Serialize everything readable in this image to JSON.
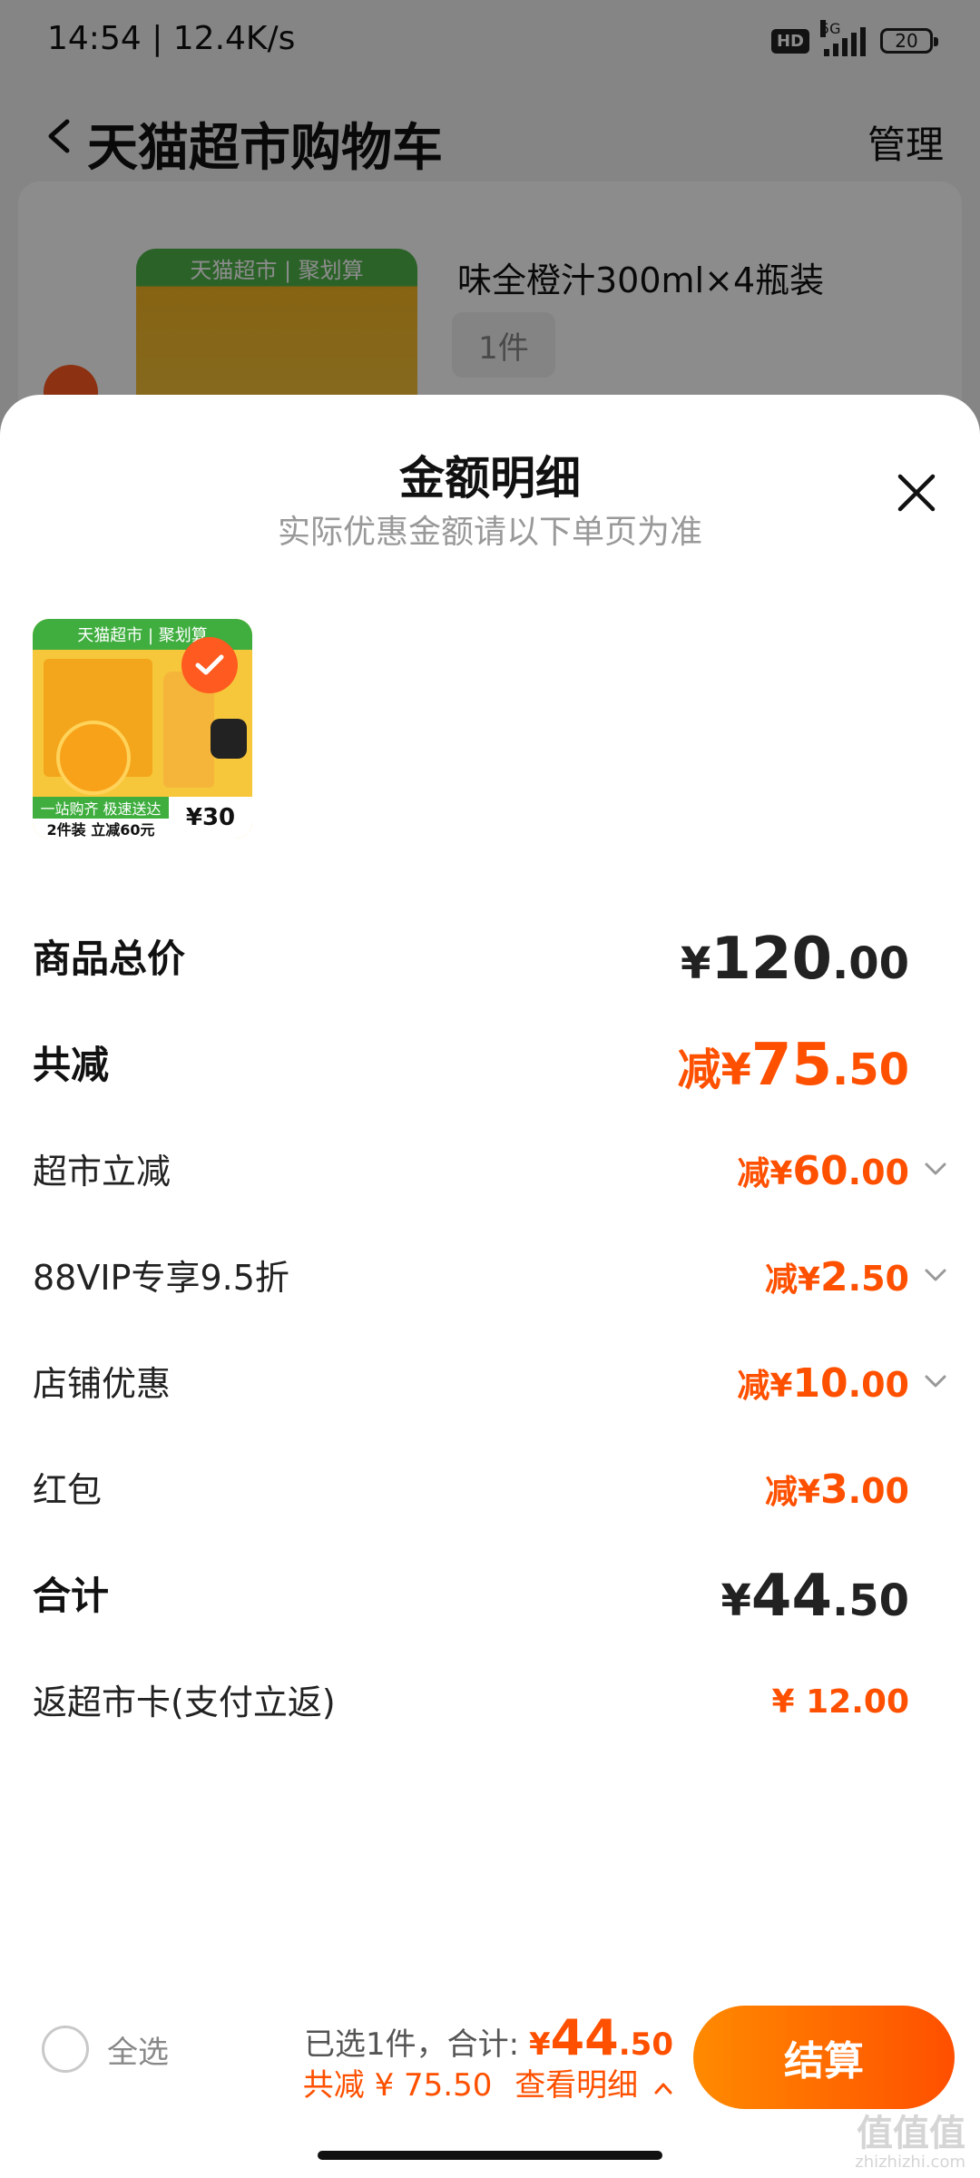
{
  "status_bar": {
    "time": "14:54 | 12.4K/s",
    "hd": "HD",
    "network": "5G",
    "battery": "20"
  },
  "nav": {
    "title": "天猫超市购物车",
    "manage": "管理"
  },
  "background_item": {
    "name": "味全橙汁300ml×4瓶装",
    "quantity": "1件",
    "thumb_tag": "天猫超市 | 聚划算"
  },
  "sheet": {
    "title": "金额明细",
    "subtitle": "实际优惠金额请以下单页为准",
    "thumb": {
      "top_tag": "天猫超市 | 聚划算",
      "strip1": "一站购齐 极速送达",
      "strip2": "2件装 立减60元",
      "price": "¥30"
    },
    "rows": [
      {
        "label": "商品总价",
        "prefix": "¥",
        "int": "120",
        "dec": ".00",
        "style": "total-black",
        "chevron": false
      },
      {
        "label": "共减",
        "prefix": "减¥",
        "int": "75",
        "dec": ".50",
        "style": "total-orange",
        "chevron": false
      },
      {
        "label": "超市立减",
        "prefix": "减¥",
        "int": "60",
        "dec": ".00",
        "style": "item",
        "chevron": true
      },
      {
        "label": "88VIP专享9.5折",
        "prefix": "减¥",
        "int": "2",
        "dec": ".50",
        "style": "item",
        "chevron": true
      },
      {
        "label": "店铺优惠",
        "prefix": "减¥",
        "int": "10",
        "dec": ".00",
        "style": "item",
        "chevron": true
      },
      {
        "label": "红包",
        "prefix": "减¥",
        "int": "3",
        "dec": ".00",
        "style": "item",
        "chevron": false
      },
      {
        "label": "合计",
        "prefix": "¥",
        "int": "44",
        "dec": ".50",
        "style": "total-black",
        "chevron": false
      },
      {
        "label": "返超市卡(支付立返)",
        "prefix": "¥ ",
        "int": "12",
        "dec": ".00",
        "style": "rebate",
        "chevron": false
      }
    ]
  },
  "bottom_bar": {
    "select_all": "全选",
    "selected_text": "已选1件，合计: ",
    "total_prefix": "¥",
    "total_int": "44",
    "total_dec": ".50",
    "discount_text": "共减 ¥ 75.50",
    "view_detail": "查看明细",
    "checkout": "结算"
  },
  "watermark": {
    "main": "值值值",
    "sub": "zhizhizhi.com"
  },
  "colors": {
    "accent": "#ff5000",
    "button_start": "#ff8a00",
    "button_end": "#ff4f00"
  }
}
